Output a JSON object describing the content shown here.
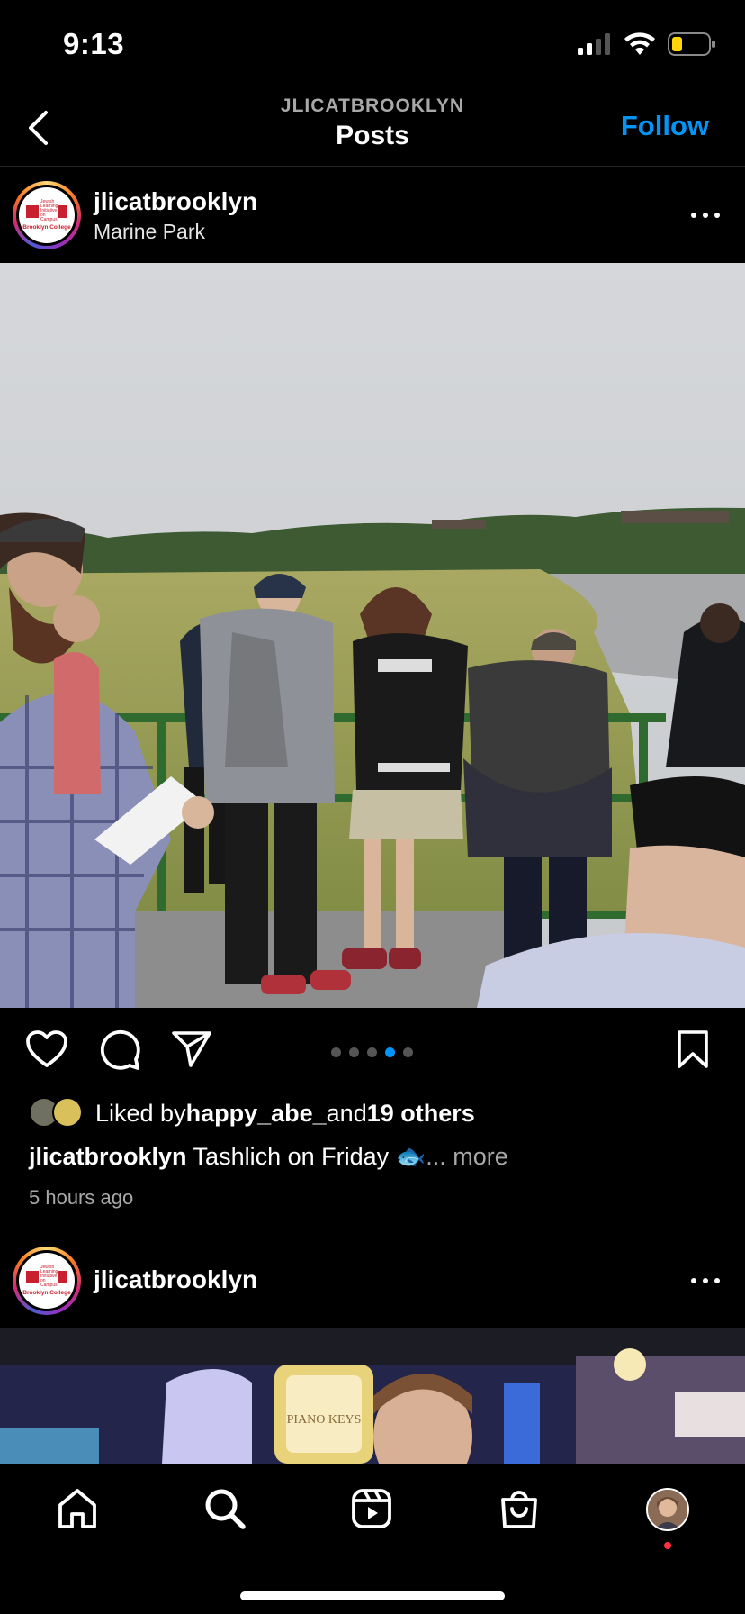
{
  "status_bar": {
    "time": "9:13"
  },
  "header": {
    "subtitle": "JLICATBROOKLYN",
    "title": "Posts",
    "follow_label": "Follow"
  },
  "post1": {
    "username": "jlicatbrooklyn",
    "location": "Marine Park",
    "carousel": {
      "total": 5,
      "active_index": 3
    },
    "likes": {
      "prefix": "Liked by ",
      "user": "happy_abe_",
      "middle": " and ",
      "others": "19 others"
    },
    "caption": {
      "username": "jlicatbrooklyn",
      "text": " Tashlich on Friday 🐟",
      "more": "... more"
    },
    "time_ago": "5 hours ago"
  },
  "post2": {
    "username": "jlicatbrooklyn",
    "sign_text": "PIANO KEYS"
  },
  "avatar_logo": {
    "line1": "Jewish Learning Initiative on Campus",
    "line2": "Brooklyn College"
  },
  "icons": {
    "back": "chevron-left-icon",
    "like": "heart-icon",
    "comment": "comment-icon",
    "share": "paper-plane-icon",
    "save": "bookmark-icon",
    "home": "home-icon",
    "search": "search-icon",
    "reels": "reels-icon",
    "shop": "shopping-bag-icon"
  },
  "colors": {
    "accent": "#0095f6",
    "background": "#000000",
    "muted": "#a8a8a8",
    "notification": "#ff3040"
  }
}
